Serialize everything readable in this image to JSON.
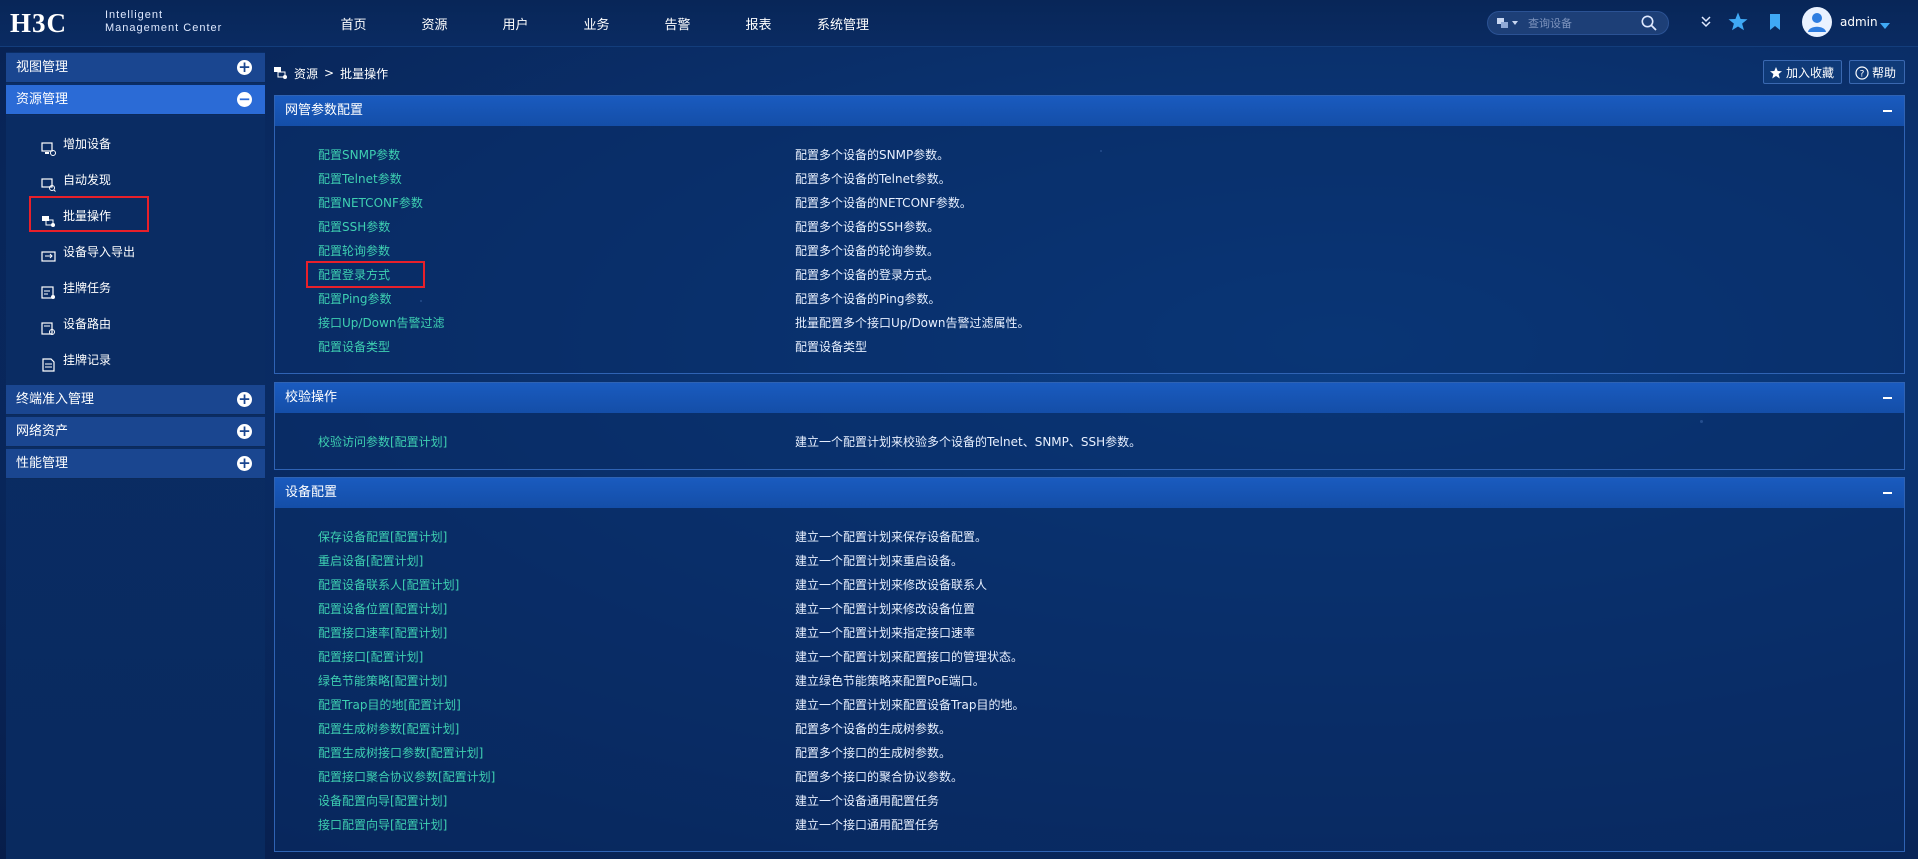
{
  "header": {
    "logo_main": "H3C",
    "logo_line1": "Intelligent",
    "logo_line2": "Management Center",
    "nav": [
      "首页",
      "资源",
      "用户",
      "业务",
      "告警",
      "报表",
      "系统管理"
    ],
    "search_placeholder": "查询设备",
    "username": "admin"
  },
  "sidebar": {
    "groups": [
      {
        "label": "视图管理",
        "toggle": "+"
      },
      {
        "label": "资源管理",
        "toggle": "−"
      },
      {
        "label": "终端准入管理",
        "toggle": "+"
      },
      {
        "label": "网络资产",
        "toggle": "+"
      },
      {
        "label": "性能管理",
        "toggle": "+"
      }
    ],
    "items": [
      {
        "label": "增加设备",
        "icon": "add-device-icon"
      },
      {
        "label": "自动发现",
        "icon": "auto-discover-icon"
      },
      {
        "label": "批量操作",
        "icon": "batch-operation-icon"
      },
      {
        "label": "设备导入导出",
        "icon": "import-export-icon"
      },
      {
        "label": "挂牌任务",
        "icon": "tag-task-icon"
      },
      {
        "label": "设备路由",
        "icon": "device-route-icon"
      },
      {
        "label": "挂牌记录",
        "icon": "tag-record-icon"
      }
    ]
  },
  "breadcrumb": {
    "root": "资源",
    "sep": ">",
    "current": "批量操作"
  },
  "actions": {
    "favorite": "加入收藏",
    "help": "帮助"
  },
  "panels": [
    {
      "title": "网管参数配置",
      "rows": [
        {
          "link": "配置SNMP参数",
          "desc": "配置多个设备的SNMP参数。"
        },
        {
          "link": "配置Telnet参数",
          "desc": "配置多个设备的Telnet参数。"
        },
        {
          "link": "配置NETCONF参数",
          "desc": "配置多个设备的NETCONF参数。"
        },
        {
          "link": "配置SSH参数",
          "desc": "配置多个设备的SSH参数。"
        },
        {
          "link": "配置轮询参数",
          "desc": "配置多个设备的轮询参数。"
        },
        {
          "link": "配置登录方式",
          "desc": "配置多个设备的登录方式。"
        },
        {
          "link": "配置Ping参数",
          "desc": "配置多个设备的Ping参数。"
        },
        {
          "link": "接口Up/Down告警过滤",
          "desc": "批量配置多个接口Up/Down告警过滤属性。"
        },
        {
          "link": "配置设备类型",
          "desc": "配置设备类型"
        }
      ]
    },
    {
      "title": "校验操作",
      "rows": [
        {
          "link": "校验访问参数[配置计划]",
          "desc": "建立一个配置计划来校验多个设备的Telnet、SNMP、SSH参数。"
        }
      ]
    },
    {
      "title": "设备配置",
      "rows": [
        {
          "link": "保存设备配置[配置计划]",
          "desc": "建立一个配置计划来保存设备配置。"
        },
        {
          "link": "重启设备[配置计划]",
          "desc": "建立一个配置计划来重启设备。"
        },
        {
          "link": "配置设备联系人[配置计划]",
          "desc": "建立一个配置计划来修改设备联系人"
        },
        {
          "link": "配置设备位置[配置计划]",
          "desc": "建立一个配置计划来修改设备位置"
        },
        {
          "link": "配置接口速率[配置计划]",
          "desc": "建立一个配置计划来指定接口速率"
        },
        {
          "link": "配置接口[配置计划]",
          "desc": "建立一个配置计划来配置接口的管理状态。"
        },
        {
          "link": "绿色节能策略[配置计划]",
          "desc": "建立绿色节能策略来配置PoE端口。"
        },
        {
          "link": "配置Trap目的地[配置计划]",
          "desc": "建立一个配置计划来配置设备Trap目的地。"
        },
        {
          "link": "配置生成树参数[配置计划]",
          "desc": "配置多个设备的生成树参数。"
        },
        {
          "link": "配置生成树接口参数[配置计划]",
          "desc": "配置多个接口的生成树参数。"
        },
        {
          "link": "配置接口聚合协议参数[配置计划]",
          "desc": "配置多个接口的聚合协议参数。"
        },
        {
          "link": "设备配置向导[配置计划]",
          "desc": "建立一个设备通用配置任务"
        },
        {
          "link": "接口配置向导[配置计划]",
          "desc": "建立一个接口通用配置任务"
        }
      ]
    }
  ],
  "colors": {
    "link": "#3ed0b2",
    "accent": "#2b6bd6",
    "highlight": "#e8202a"
  }
}
